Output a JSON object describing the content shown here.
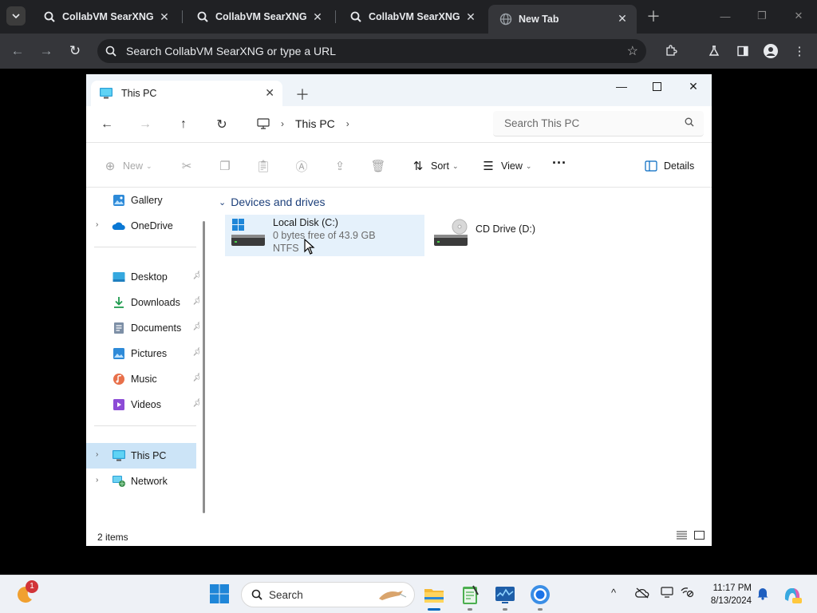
{
  "browser": {
    "tabs": [
      {
        "title": "CollabVM SearXNG",
        "active": false
      },
      {
        "title": "CollabVM SearXNG",
        "active": false
      },
      {
        "title": "CollabVM SearXNG",
        "active": false
      },
      {
        "title": "New Tab",
        "active": true
      }
    ],
    "omnibox_placeholder": "Search CollabVM SearXNG or type a URL"
  },
  "explorer": {
    "tab_title": "This PC",
    "breadcrumb": [
      "This PC"
    ],
    "search_placeholder": "Search This PC",
    "commands": {
      "new": "New",
      "sort": "Sort",
      "view": "View",
      "details": "Details"
    },
    "sidebar": {
      "top": [
        {
          "label": "Gallery",
          "icon": "gallery-icon",
          "expandable": false
        },
        {
          "label": "OneDrive",
          "icon": "onedrive-icon",
          "expandable": true
        }
      ],
      "quick_access": [
        {
          "label": "Desktop",
          "icon": "desktop-folder-icon",
          "pinned": true
        },
        {
          "label": "Downloads",
          "icon": "downloads-folder-icon",
          "pinned": true
        },
        {
          "label": "Documents",
          "icon": "documents-folder-icon",
          "pinned": true
        },
        {
          "label": "Pictures",
          "icon": "pictures-folder-icon",
          "pinned": true
        },
        {
          "label": "Music",
          "icon": "music-folder-icon",
          "pinned": true
        },
        {
          "label": "Videos",
          "icon": "videos-folder-icon",
          "pinned": true
        }
      ],
      "locations": [
        {
          "label": "This PC",
          "icon": "this-pc-icon",
          "selected": true
        },
        {
          "label": "Network",
          "icon": "network-icon",
          "selected": false
        }
      ]
    },
    "group_title": "Devices and drives",
    "drives": [
      {
        "name": "Local Disk (C:)",
        "space": "0 bytes free of 43.9 GB",
        "fs": "NTFS",
        "selected": true
      },
      {
        "name": "CD Drive (D:)",
        "selected": false
      }
    ],
    "status": "2 items"
  },
  "taskbar": {
    "search_label": "Search",
    "notification_count": "1",
    "time": "11:17 PM",
    "date": "8/13/2024"
  },
  "colors": {
    "accent": "#0067c0",
    "selection": "#cce4f7",
    "group_title": "#1c3f7a"
  }
}
